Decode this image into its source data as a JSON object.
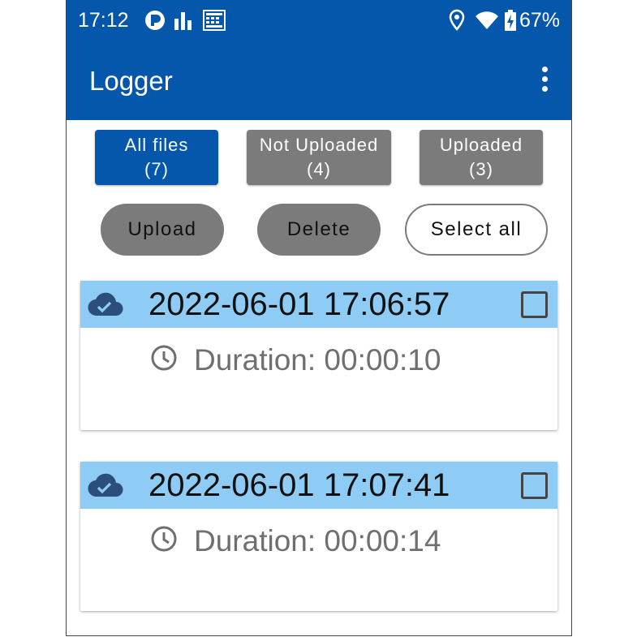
{
  "status_bar": {
    "time": "17:12",
    "battery_percent": "67%"
  },
  "app_bar": {
    "title": "Logger",
    "menu_icon": "more-vert-icon"
  },
  "filters": [
    {
      "label": "All files",
      "count": "(7)",
      "active": true
    },
    {
      "label": "Not Uploaded",
      "count": "(4)",
      "active": false
    },
    {
      "label": "Uploaded",
      "count": "(3)",
      "active": false
    }
  ],
  "actions": {
    "upload": "Upload",
    "delete": "Delete",
    "select_all": "Select all"
  },
  "files": [
    {
      "title": "2022-06-01 17:06:57",
      "duration": "Duration: 00:00:10",
      "uploaded": true,
      "checked": false
    },
    {
      "title": "2022-06-01 17:07:41",
      "duration": "Duration: 00:00:14",
      "uploaded": true,
      "checked": false
    }
  ],
  "colors": {
    "primary": "#0557ab",
    "card_header": "#8ecbf5",
    "inactive": "#7b7b7b"
  }
}
